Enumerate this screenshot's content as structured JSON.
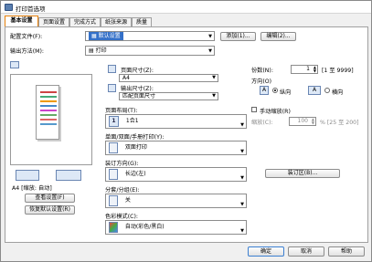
{
  "window": {
    "title": "打印首选项"
  },
  "tabs": [
    {
      "label": "基本设置",
      "active": true
    },
    {
      "label": "页面设置"
    },
    {
      "label": "完成方式"
    },
    {
      "label": "纸张来源"
    },
    {
      "label": "质量"
    }
  ],
  "profile": {
    "label": "配置文件(F):",
    "value": "默认设置",
    "add": "添加(1)...",
    "edit": "编辑(2)..."
  },
  "output": {
    "label": "输出方法(M):",
    "value": "打印"
  },
  "page_size": {
    "label": "页面尺寸(Z):",
    "value": "A4"
  },
  "output_size": {
    "label": "输出尺寸(Z):",
    "value": "匹配页面尺寸"
  },
  "copies": {
    "label": "份数(N):",
    "value": "1",
    "range": "[1 至 9999]"
  },
  "orientation": {
    "label": "方向(O)",
    "portrait": "纵向",
    "landscape": "横向",
    "portrait_glyph": "A",
    "landscape_glyph": "A"
  },
  "page_layout": {
    "label": "页面布局(T):",
    "value": "1合1",
    "glyph": "1"
  },
  "manual_scaling": {
    "label": "手动缩放(R)",
    "scale_label": "缩放(C):",
    "scale_value": "100",
    "scale_range": "% [25 至 200]"
  },
  "duplex": {
    "label": "单面/双面/手册打印(Y):",
    "value": "双面打印"
  },
  "binding": {
    "label": "装订方向(G):",
    "value": "长边(左)",
    "btn": "装订区(B)..."
  },
  "collate": {
    "label": "分套/分组(E):",
    "value": "关"
  },
  "color_mode": {
    "label": "色彩模式(C):",
    "value": "自动(彩色/黑白)"
  },
  "preview": {
    "caption": "A4 [缩放: 自动]",
    "view_settings": "查看设置(F)",
    "restore_defaults": "恢复默认设置(R)"
  },
  "buttons": {
    "ok": "确定",
    "cancel": "取消",
    "apply": "应用(A)",
    "help": "帮助"
  }
}
